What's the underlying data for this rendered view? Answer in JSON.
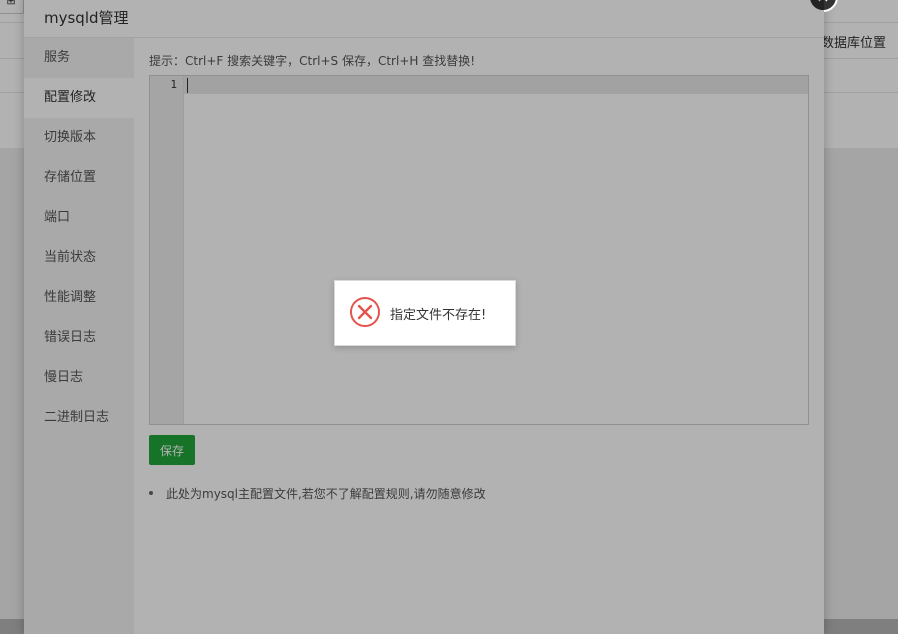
{
  "background": {
    "top_left_button": "⊞",
    "right_link": "数据库位置"
  },
  "modal": {
    "title": "mysqld管理",
    "close_icon": "close-icon"
  },
  "sidebar": {
    "items": [
      {
        "label": "服务",
        "active": false
      },
      {
        "label": "配置修改",
        "active": true
      },
      {
        "label": "切换版本",
        "active": false
      },
      {
        "label": "存储位置",
        "active": false
      },
      {
        "label": "端口",
        "active": false
      },
      {
        "label": "当前状态",
        "active": false
      },
      {
        "label": "性能调整",
        "active": false
      },
      {
        "label": "错误日志",
        "active": false
      },
      {
        "label": "慢日志",
        "active": false
      },
      {
        "label": "二进制日志",
        "active": false
      }
    ]
  },
  "content": {
    "hint": "提示：Ctrl+F 搜索关键字，Ctrl+S 保存，Ctrl+H 查找替换!",
    "editor": {
      "line_number": "1",
      "value": ""
    },
    "save_label": "保存",
    "notes": [
      "此处为mysql主配置文件,若您不了解配置规则,请勿随意修改"
    ]
  },
  "toast": {
    "icon": "error-circle-icon",
    "message": "指定文件不存在!",
    "icon_color": "#e5534b"
  },
  "colors": {
    "accent_green": "#20a53a"
  }
}
